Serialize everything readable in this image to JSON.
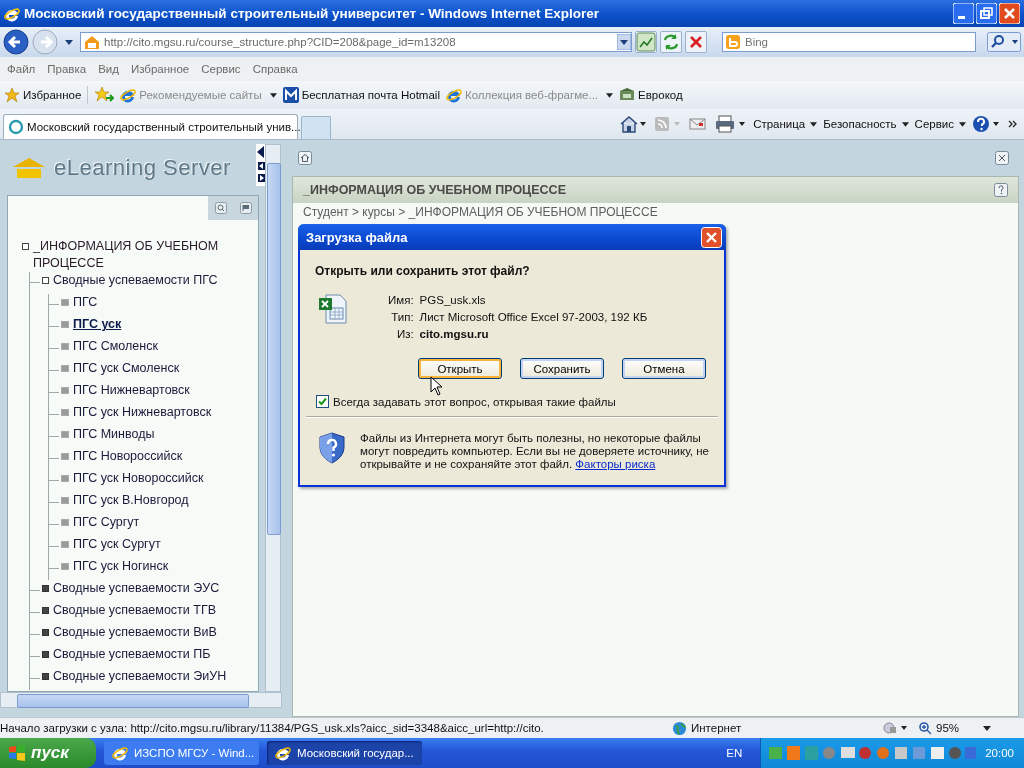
{
  "window": {
    "title": "Московский государственный строительный университет - Windows Internet Explorer"
  },
  "address_bar": {
    "url": "http://cito.mgsu.ru/course_structure.php?CID=208&page_id=m13208"
  },
  "search": {
    "placeholder": "Bing"
  },
  "menu": [
    "Файл",
    "Правка",
    "Вид",
    "Избранное",
    "Сервис",
    "Справка"
  ],
  "favorites_bar": [
    {
      "label": "Избранное",
      "kind": "button",
      "dimmed": false
    },
    {
      "label": "Рекомендуемые сайты",
      "kind": "menu",
      "dimmed": true
    },
    {
      "label": "Бесплатная почта Hotmail",
      "kind": "button",
      "dimmed": false
    },
    {
      "label": "Коллекция веб-фрагме...",
      "kind": "menu",
      "dimmed": true
    },
    {
      "label": "Еврокод",
      "kind": "button",
      "dimmed": false
    }
  ],
  "tab": {
    "title": "Московский государственный строительный унив..."
  },
  "command_bar": [
    "Страница",
    "Безопасность",
    "Сервис"
  ],
  "logo": "eLearning Server",
  "tree": [
    {
      "label": "_ИНФОРМАЦИЯ ОБ УЧЕБНОМ ПРОЦЕССЕ",
      "expanded": true,
      "selected": false,
      "children": [
        {
          "label": "Сводные успеваемости ПГС",
          "expanded": true,
          "selected": false,
          "children": [
            {
              "label": "ПГС",
              "selected": false
            },
            {
              "label": "ПГС уск",
              "selected": true
            },
            {
              "label": "ПГС Смоленск",
              "selected": false
            },
            {
              "label": "ПГС уск Смоленск",
              "selected": false
            },
            {
              "label": "ПГС Нижневартовск",
              "selected": false
            },
            {
              "label": "ПГС уск Нижневартовск",
              "selected": false
            },
            {
              "label": "ПГС Минводы",
              "selected": false
            },
            {
              "label": "ПГС Новороссийск",
              "selected": false
            },
            {
              "label": "ПГС уск Новороссийск",
              "selected": false
            },
            {
              "label": "ПГС уск В.Новгород",
              "selected": false
            },
            {
              "label": "ПГС Сургут",
              "selected": false
            },
            {
              "label": "ПГС уск Сургут",
              "selected": false
            },
            {
              "label": "ПГС уск Ногинск",
              "selected": false
            }
          ]
        },
        {
          "label": "Сводные успеваемости ЭУС",
          "expanded": false,
          "selected": false
        },
        {
          "label": "Сводные успеваемости ТГВ",
          "expanded": false,
          "selected": false
        },
        {
          "label": "Сводные успеваемости ВиВ",
          "expanded": false,
          "selected": false
        },
        {
          "label": "Сводные успеваемости ПБ",
          "expanded": false,
          "selected": false
        },
        {
          "label": "Сводные успеваемости ЭиУН",
          "expanded": false,
          "selected": false
        }
      ]
    }
  ],
  "content": {
    "panel_title": "_ИНФОРМАЦИЯ ОБ УЧЕБНОМ ПРОЦЕССЕ",
    "breadcrumb": "Студент > курсы > _ИНФОРМАЦИЯ ОБ УЧЕБНОМ ПРОЦЕССЕ"
  },
  "dialog": {
    "title": "Загрузка файла",
    "question": "Открыть или сохранить этот файл?",
    "fields": [
      {
        "label": "Имя:",
        "value": "PGS_usk.xls",
        "emphasis": false
      },
      {
        "label": "Тип:",
        "value": "Лист Microsoft Office Excel 97-2003, 192 КБ",
        "emphasis": false
      },
      {
        "label": "Из:",
        "value": "cito.mgsu.ru",
        "emphasis": true
      }
    ],
    "buttons": [
      {
        "label": "Открыть",
        "default": true
      },
      {
        "label": "Сохранить",
        "default": false
      },
      {
        "label": "Отмена",
        "default": false
      }
    ],
    "checkbox": {
      "label": "Всегда задавать этот вопрос, открывая такие файлы",
      "checked": true
    },
    "warning": {
      "text": "Файлы из Интернета могут быть полезны, но некоторые файлы могут повредить компьютер. Если вы не доверяете источнику, не открывайте и не сохраняйте этот файл.",
      "link": "Факторы риска"
    }
  },
  "status_bar": {
    "text": "Начало загрузки с узла: http://cito.mgsu.ru/library/11384/PGS_usk.xls?aicc_sid=3348&aicc_url=http://cito.",
    "zone": "Интернет",
    "zoom": "95%"
  },
  "taskbar": {
    "start": "пуск",
    "tasks": [
      {
        "label": "ИЗСПО МГСУ - Wind...",
        "selected": false
      },
      {
        "label": "Московский государ...",
        "selected": true
      }
    ],
    "language": "EN",
    "clock": "20:00"
  }
}
